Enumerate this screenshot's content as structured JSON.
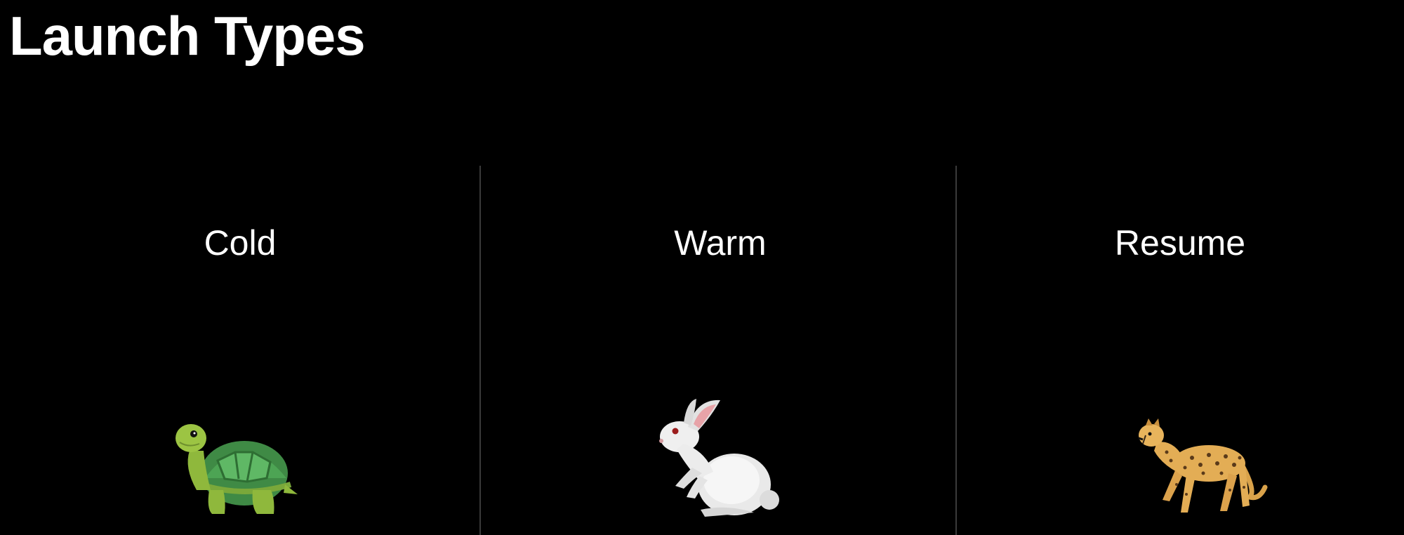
{
  "slide": {
    "title": "Launch Types",
    "background": "#000000",
    "text_color": "#ffffff",
    "divider_color": "#3a3a3a"
  },
  "columns": [
    {
      "label": "Cold",
      "icon": "turtle-icon"
    },
    {
      "label": "Warm",
      "icon": "rabbit-icon"
    },
    {
      "label": "Resume",
      "icon": "cheetah-icon"
    }
  ]
}
